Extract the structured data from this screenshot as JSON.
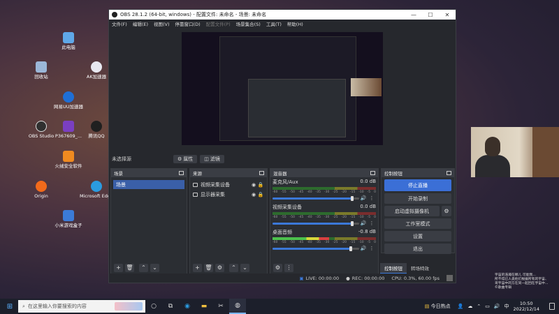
{
  "desktop": {
    "icons": [
      {
        "label": "此电脑",
        "icon": "computer-icon",
        "color": "#5fa8e8"
      },
      {
        "label": "回收站",
        "icon": "recycle-bin-icon",
        "color": "#9bb7d8"
      },
      {
        "label": "AK加速器",
        "icon": "ak-accelerator-icon",
        "color": "#e8e8f0"
      },
      {
        "label": "网易UU加速器",
        "icon": "uu-accelerator-icon",
        "color": "#1f6fd6"
      },
      {
        "label": "OBS Studio",
        "icon": "obs-icon",
        "color": "#303030"
      },
      {
        "label": "P367609_...",
        "icon": "purple-file-icon",
        "color": "#7a3fc0"
      },
      {
        "label": "腾讯QQ",
        "icon": "qq-icon",
        "color": "#202020"
      },
      {
        "label": "火绒安全软件",
        "icon": "huorong-icon",
        "color": "#f08a20"
      },
      {
        "label": "Origin",
        "icon": "origin-icon",
        "color": "#f26a1b"
      },
      {
        "label": "Microsoft Edge",
        "icon": "edge-icon",
        "color": "#2b9be0"
      },
      {
        "label": "小米游戏盒子",
        "icon": "xiaomi-game-icon",
        "color": "#3b7bd8"
      }
    ]
  },
  "obs": {
    "title": "OBS 28.1.2 (64-bit, windows) - 配置文件: 未命名 - 场景: 未命名",
    "menu": [
      "文件(F)",
      "编辑(E)",
      "视图(V)",
      "停靠窗口(D)",
      "配置文件(P)",
      "场景集合(S)",
      "工具(T)",
      "帮助(H)"
    ],
    "source_bar": {
      "no_source": "未选择源",
      "properties": "属性",
      "filters": "滤镜"
    },
    "scenes": {
      "header": "场景",
      "items": [
        "场景"
      ]
    },
    "sources": {
      "header": "来源",
      "items": [
        "视频采集设备",
        "显示器采集"
      ]
    },
    "mixer": {
      "header": "混音器",
      "ticks": [
        "-60",
        "-55",
        "-50",
        "-45",
        "-40",
        "-35",
        "-30",
        "-25",
        "-20",
        "-15",
        "-10",
        "-5",
        "0"
      ],
      "channels": [
        {
          "name": "麦克风/Aux",
          "db": "0.0 dB",
          "level": 0.0,
          "volume": 0.92
        },
        {
          "name": "视频采集设备",
          "db": "0.0 dB",
          "level": 0.0,
          "volume": 0.92
        },
        {
          "name": "桌面音频",
          "db": "-0.8 dB",
          "level": 0.55,
          "volume": 0.9
        }
      ]
    },
    "controls": {
      "header": "控制按钮",
      "stop_stream": "停止直播",
      "start_record": "开始录制",
      "virtual_cam": "启动虚拟摄像机",
      "studio_mode": "工作室模式",
      "settings": "设置",
      "exit": "退出"
    },
    "tabs": [
      "控制按钮",
      "转场特效"
    ],
    "status": {
      "live": "LIVE: 00:00:00",
      "rec": "REC: 00:00:00",
      "cpu": "CPU: 0.3%, 60.00 fps"
    }
  },
  "taskbar": {
    "search_placeholder": "在这里输入你要搜索的内容",
    "news": "今日热点",
    "time": "10:50",
    "date": "2022/12/14"
  },
  "lyrics": [
    "宇宙的浩瀚在哪儿 可能我...",
    "所不得已人类他们根据所有的宇宙、",
    "哥宇宙中的方在同一起回在宇宙中...",
    "©歌曲专辑"
  ]
}
